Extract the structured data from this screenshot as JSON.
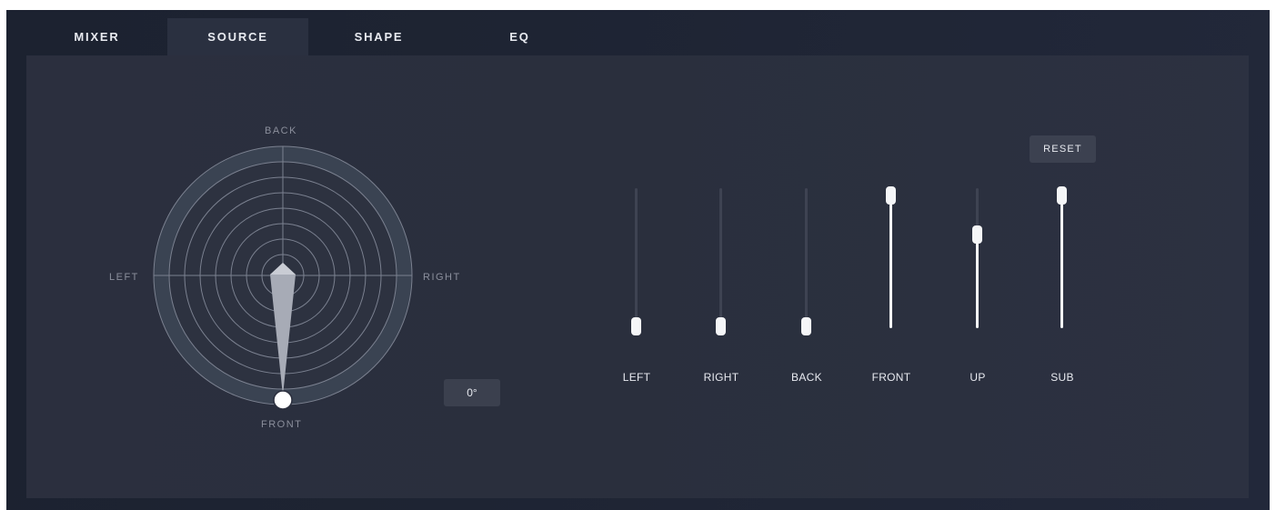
{
  "tabs": [
    {
      "label": "MIXER"
    },
    {
      "label": "SOURCE"
    },
    {
      "label": "SHAPE"
    },
    {
      "label": "EQ"
    }
  ],
  "active_tab": "SOURCE",
  "direction": {
    "back": "BACK",
    "left": "LEFT",
    "right": "RIGHT",
    "front": "FRONT",
    "angle_display": "0°"
  },
  "reset_label": "RESET",
  "sliders": [
    {
      "label": "LEFT",
      "value": 0.0
    },
    {
      "label": "RIGHT",
      "value": 0.0
    },
    {
      "label": "BACK",
      "value": 0.0
    },
    {
      "label": "FRONT",
      "value": 1.0
    },
    {
      "label": "UP",
      "value": 0.7
    },
    {
      "label": "SUB",
      "value": 1.0
    }
  ],
  "colors": {
    "accent": "#f5f6f8",
    "panel": "#2b2f3e",
    "background": "#1e2433"
  }
}
